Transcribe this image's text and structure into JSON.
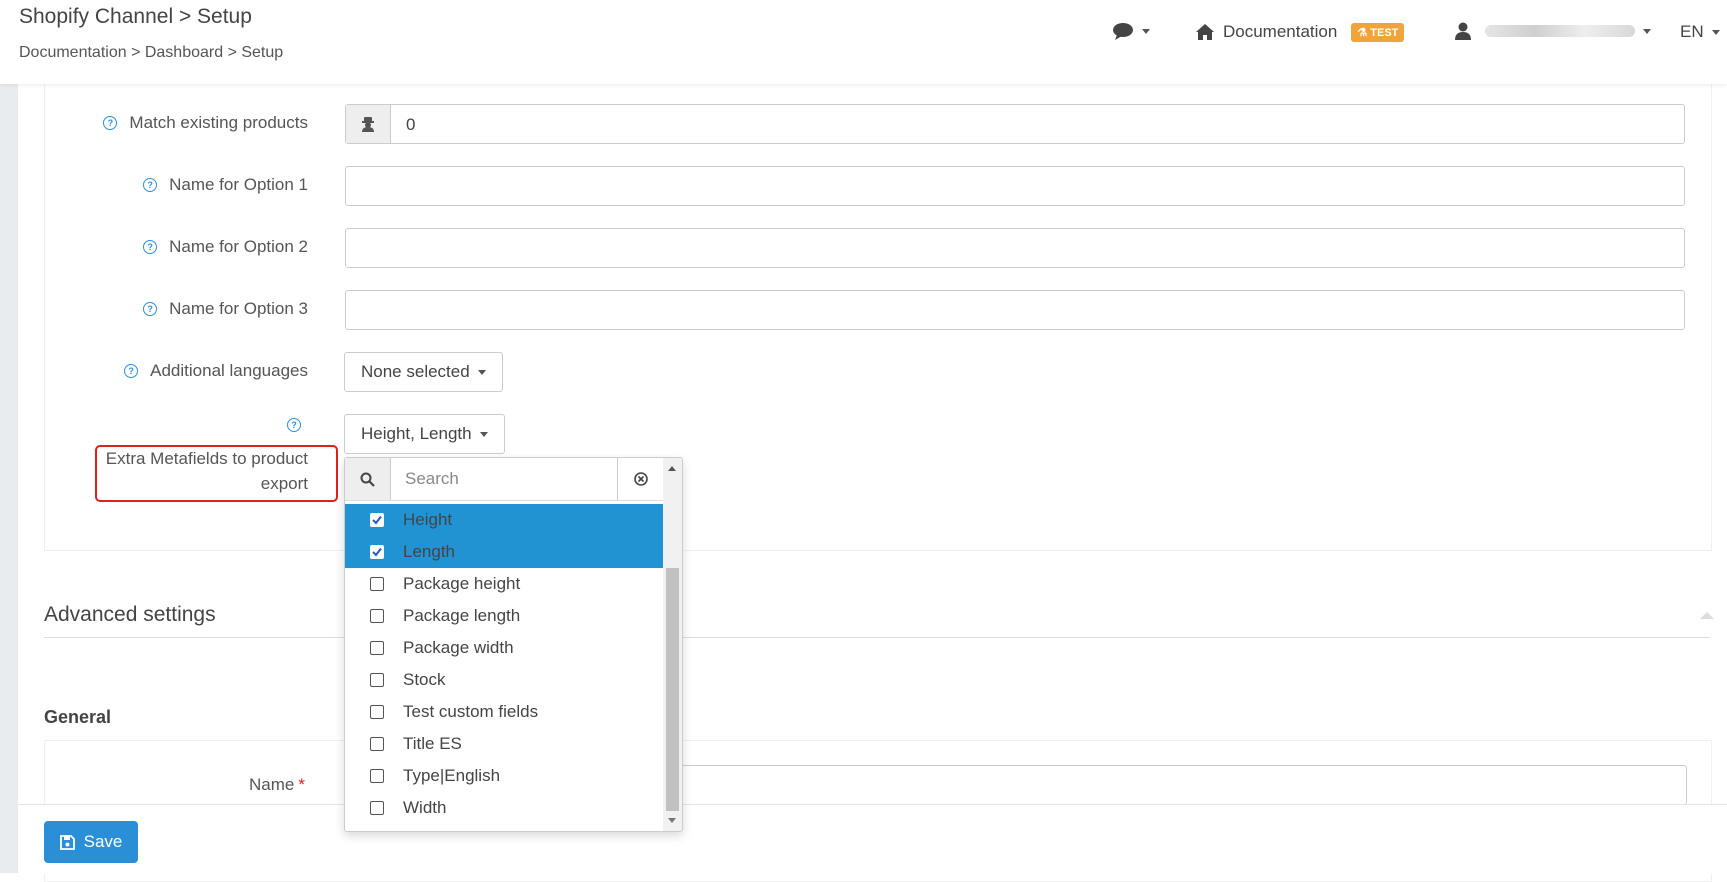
{
  "header": {
    "title": "Shopify Channel > Setup",
    "breadcrumb": "Documentation > Dashboard > Setup",
    "documentation_label": "Documentation",
    "test_badge": "TEST",
    "language": "EN"
  },
  "form": {
    "match_existing_label": "Match existing products",
    "match_existing_value": "0",
    "option1_label": "Name for Option 1",
    "option2_label": "Name for Option 2",
    "option3_label": "Name for Option 3",
    "additional_languages_label": "Additional languages",
    "additional_languages_value": "None selected",
    "extra_metafields_label": "Extra Metafields to product export",
    "extra_metafields_value": "Height, Length"
  },
  "dropdown": {
    "search_placeholder": "Search",
    "items": [
      {
        "label": "Height",
        "checked": true
      },
      {
        "label": "Length",
        "checked": true
      },
      {
        "label": "Package height",
        "checked": false
      },
      {
        "label": "Package length",
        "checked": false
      },
      {
        "label": "Package width",
        "checked": false
      },
      {
        "label": "Stock",
        "checked": false
      },
      {
        "label": "Test custom fields",
        "checked": false
      },
      {
        "label": "Title ES",
        "checked": false
      },
      {
        "label": "Type|English",
        "checked": false
      },
      {
        "label": "Width",
        "checked": false
      }
    ]
  },
  "advanced": {
    "title": "Advanced settings",
    "general_title": "General",
    "name_label": "Name",
    "required_mark": "*"
  },
  "footer": {
    "save_label": "Save"
  },
  "colors": {
    "primary": "#2193d3",
    "badge": "#f0a43a",
    "highlight": "#e02020"
  }
}
